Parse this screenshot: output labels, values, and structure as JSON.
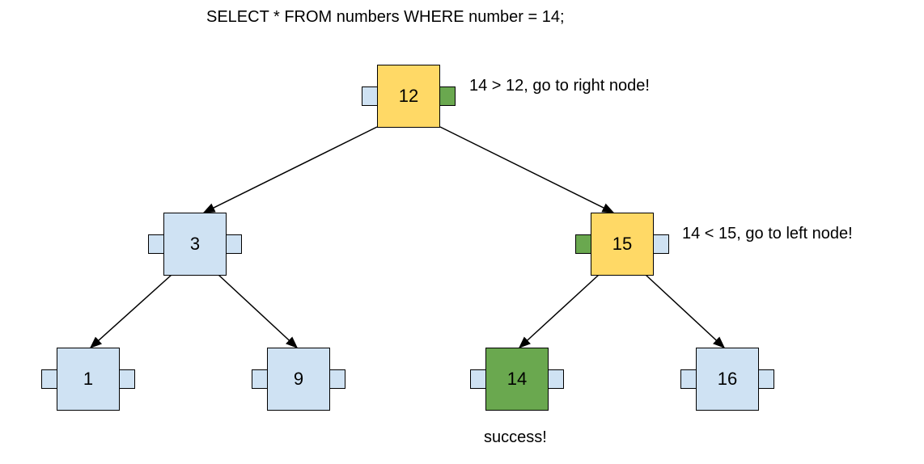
{
  "query": "SELECT * FROM numbers WHERE number = 14;",
  "colors": {
    "blue": "#cfe2f3",
    "yellow": "#ffd966",
    "green_tab": "#6aa84f",
    "green_node": "#6aa84f"
  },
  "nodes": {
    "root": {
      "value": "12",
      "fill": "yellow",
      "left_tab": "blue",
      "right_tab": "green"
    },
    "n3": {
      "value": "3",
      "fill": "blue",
      "left_tab": "blue",
      "right_tab": "blue"
    },
    "n15": {
      "value": "15",
      "fill": "yellow",
      "left_tab": "green",
      "right_tab": "blue"
    },
    "n1": {
      "value": "1",
      "fill": "blue",
      "left_tab": "blue",
      "right_tab": "blue"
    },
    "n9": {
      "value": "9",
      "fill": "blue",
      "left_tab": "blue",
      "right_tab": "blue"
    },
    "n14": {
      "value": "14",
      "fill": "green",
      "left_tab": "blue",
      "right_tab": "blue"
    },
    "n16": {
      "value": "16",
      "fill": "blue",
      "left_tab": "blue",
      "right_tab": "blue"
    }
  },
  "annotations": {
    "root": "14 > 12, go to right node!",
    "n15": "14 < 15, go to left node!",
    "success": "success!"
  },
  "tree_structure": {
    "root": "12",
    "children": {
      "12": [
        "3",
        "15"
      ],
      "3": [
        "1",
        "9"
      ],
      "15": [
        "14",
        "16"
      ]
    },
    "search_target": 14,
    "search_path": [
      "12",
      "15",
      "14"
    ]
  }
}
